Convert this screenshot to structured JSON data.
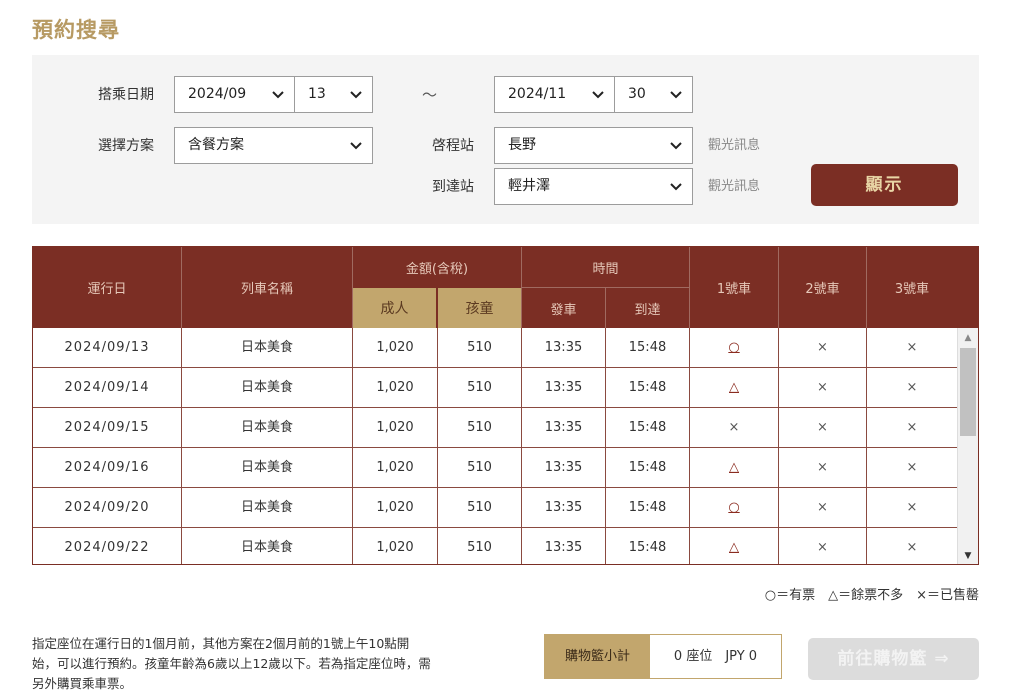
{
  "page_title": "預約搜尋",
  "search": {
    "date_label": "搭乘日期",
    "date_from_month": "2024/09",
    "date_from_day": "13",
    "tilde": "～",
    "date_to_month": "2024/11",
    "date_to_day": "30",
    "plan_label": "選擇方案",
    "plan_value": "含餐方案",
    "depart_label": "啓程站",
    "depart_value": "長野",
    "arrive_label": "到達站",
    "arrive_value": "輕井澤",
    "sightseeing_link": "觀光訊息",
    "show_button": "顯示"
  },
  "table": {
    "headers": {
      "date": "運行日",
      "train": "列車名稱",
      "price": "金額(含稅)",
      "adult": "成人",
      "child": "孩童",
      "time": "時間",
      "depart": "發車",
      "arrive": "到達",
      "car1": "1號車",
      "car2": "2號車",
      "car3": "3號車"
    },
    "rows": [
      {
        "date": "2024/09/13",
        "train": "日本美食",
        "adult": "1,020",
        "child": "510",
        "depart": "13:35",
        "arrive": "15:48",
        "car1": "○",
        "car2": "×",
        "car3": "×"
      },
      {
        "date": "2024/09/14",
        "train": "日本美食",
        "adult": "1,020",
        "child": "510",
        "depart": "13:35",
        "arrive": "15:48",
        "car1": "△",
        "car2": "×",
        "car3": "×"
      },
      {
        "date": "2024/09/15",
        "train": "日本美食",
        "adult": "1,020",
        "child": "510",
        "depart": "13:35",
        "arrive": "15:48",
        "car1": "×",
        "car2": "×",
        "car3": "×"
      },
      {
        "date": "2024/09/16",
        "train": "日本美食",
        "adult": "1,020",
        "child": "510",
        "depart": "13:35",
        "arrive": "15:48",
        "car1": "△",
        "car2": "×",
        "car3": "×"
      },
      {
        "date": "2024/09/20",
        "train": "日本美食",
        "adult": "1,020",
        "child": "510",
        "depart": "13:35",
        "arrive": "15:48",
        "car1": "○",
        "car2": "×",
        "car3": "×"
      },
      {
        "date": "2024/09/22",
        "train": "日本美食",
        "adult": "1,020",
        "child": "510",
        "depart": "13:35",
        "arrive": "15:48",
        "car1": "△",
        "car2": "×",
        "car3": "×"
      }
    ]
  },
  "legend": "○＝有票　△＝餘票不多　×＝已售罄",
  "note": "指定座位在運行日的1個月前，其他方案在2個月前的1號上午10點開始，可以進行預約。孩童年齡為6歲以上12歲以下。若為指定座位時，需另外購買乘車票。",
  "cart": {
    "label": "購物籃小計",
    "value": "0 座位　JPY 0",
    "go_button": "前往購物籃 ⇒"
  },
  "colors": {
    "brand_dark": "#7b2e24",
    "brand_gold": "#c2a66d",
    "title_gold": "#b79a63"
  }
}
